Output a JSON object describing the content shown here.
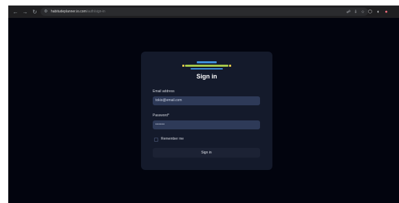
{
  "browser": {
    "url_host": "habitudeplanner.io.com",
    "url_path": "/auth/sign-in",
    "nav": {
      "back": "←",
      "forward": "→",
      "reload": "↻"
    },
    "site_icon": "tune-icon",
    "omni_actions": [
      "☍",
      "⇩",
      "☆"
    ],
    "right_actions": [
      "⬡",
      "◐",
      "●"
    ]
  },
  "card": {
    "title": "Sign in",
    "email": {
      "label": "Email address",
      "value": "tokio@email.com"
    },
    "password": {
      "label": "Password*",
      "value": "••••••"
    },
    "remember_label": "Remember me",
    "submit_label": "Sign in"
  },
  "colors": {
    "page_bg": "#02040e",
    "card_bg": "#141a2b",
    "input_bg": "#2e3a58",
    "logo_blue": "#3f8fd8",
    "logo_green": "#a7c94a"
  }
}
